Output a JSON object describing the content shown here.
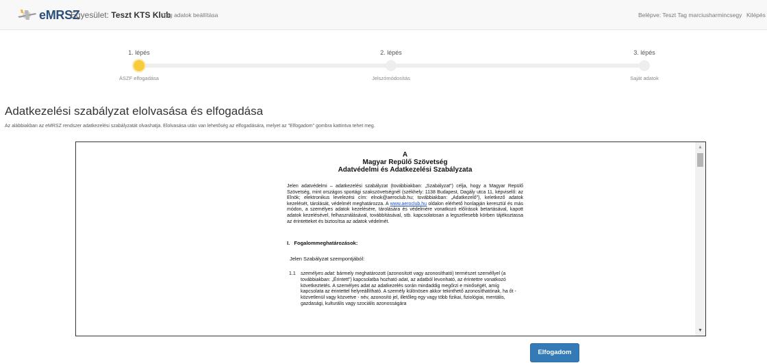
{
  "navbar": {
    "brand": "eMRSZ",
    "club_label": "Egyesület:",
    "club_name": "Teszt KTS Klub",
    "settings_link": "Tag adatok beállítása",
    "logged_in": "Belépve: Teszt Tag marciusharmincsegy",
    "logout": "Kilépés"
  },
  "stepper": {
    "steps": [
      {
        "title": "1. lépés",
        "subtitle": "ÁSZF elfogadása",
        "active": true
      },
      {
        "title": "2. lépés",
        "subtitle": "Jelszómódosítás",
        "active": false
      },
      {
        "title": "3. lépés",
        "subtitle": "Saját adatok",
        "active": false
      }
    ]
  },
  "page": {
    "heading": "Adatkezelési szabályzat elolvasása és elfogadása",
    "description": "Az alábbiakban az eMRSZ rendszer adatkezelési szabályzatát olvashatja. Elolvasása után van lehetőség az elfogadására, melyet az \"Elfogadom\" gombra kattintva tehet meg."
  },
  "document": {
    "title_line1": "A",
    "title_line2": "Magyar Repülő Szövetség",
    "title_line3": "Adatvédelmi és Adatkezelési Szabályzata",
    "para_before_link": "Jelen adatvédelmi – adatkezelési szabályzat (továbbiakban: „Szabályzat\") célja, hogy a Magyar Repülő Szövetség, mint országos sportági szakszövetségnél (székhely: 1138 Budapest, Dagály utca 11, képviselő: az Elnök; elektronikus levelezési cím: elnok@aeroclub.hu; továbbiakban: „Adatkezelő\"), keletkező adatok kezelését, tárolását, védelmét meghatározza. A ",
    "link": "www.aeroclub.hu",
    "para_after_link": " oldalon elérhető honlapján keresztül és más módon, a személyes adatok kezelésére, tárolására és védelmére vonatkozó előírások betartásával, kapott adatok kezelésével, felhasználásával, továbbításával, stb. kapcsolatosan a legszélesebb körben tájékoztassa az érintetteket és biztosítsa az adatok védelmét.",
    "section1": "I.   Fogalommeghatározások:",
    "intro": "Jelen Szabályzat szempontjából:",
    "item1_num": "1.1",
    "item1_term": "személyes adat:",
    "item1_text": " bármely meghatározott (azonosított vagy azonosítható) természet személlyel (a továbbiakban: „Érintett\") kapcsolatba hozható adat, az adatból levonható, az érintettre vonatkozó következtetés. A személyes adat az adatkezelés során mindaddig megőrzi e minőségét, amíg kapcsolata az érintettel helyreállítható. A személy különösen akkor tekinthető azonosíthatónak, ha őt - közvetlenül vagy közvetve - név, azonosító jel, illetőleg egy vagy több fizikai, fiziológiai, mentális, gazdasági, kulturális vagy szociális azonosságára"
  },
  "buttons": {
    "accept": "Elfogadom"
  },
  "colors": {
    "active_step": "#f6cb3c",
    "primary_button": "#337ab7",
    "brand": "#2a4f78"
  }
}
